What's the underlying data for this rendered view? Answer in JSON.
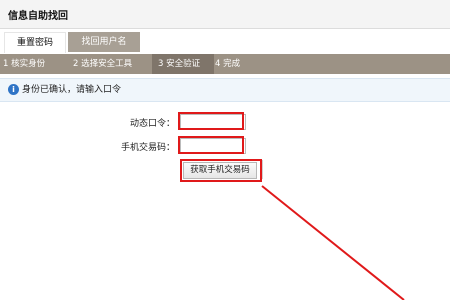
{
  "window": {
    "title": "信息自助找回"
  },
  "tabs": [
    {
      "label": "重置密码"
    },
    {
      "label": "找回用户名"
    }
  ],
  "steps": [
    {
      "label": "1 核实身份"
    },
    {
      "label": "2 选择安全工具"
    },
    {
      "label": "3 安全验证"
    },
    {
      "label": "4 完成"
    }
  ],
  "info": {
    "text": "身份已确认，请输入口令"
  },
  "form": {
    "otp_label": "动态口令：",
    "otp_value": "",
    "sms_label": "手机交易码：",
    "sms_value": "",
    "get_sms_button": "获取手机交易码"
  },
  "colors": {
    "highlight_red": "#e0191a",
    "active_tab": "#a8a095",
    "steps_bar": "#9c9285",
    "active_step": "#7f756a",
    "info_icon": "#2f74c6"
  }
}
